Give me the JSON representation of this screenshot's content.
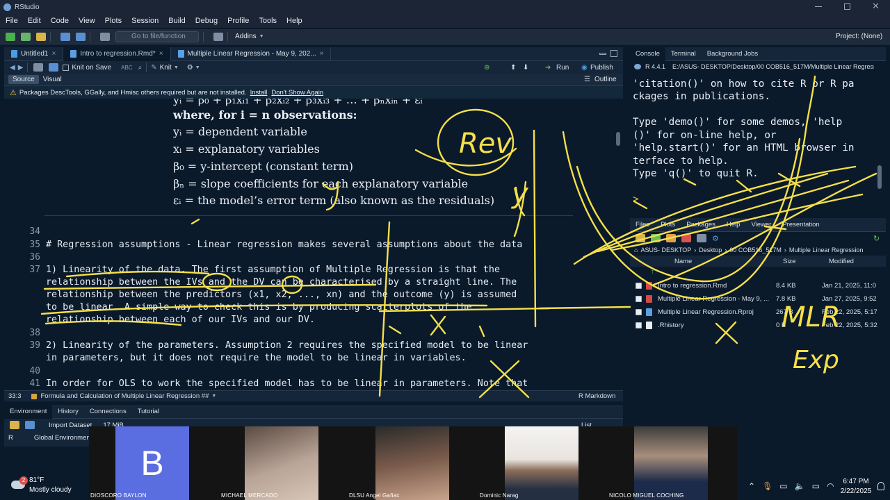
{
  "app": {
    "title": "RStudio"
  },
  "menu": [
    "File",
    "Edit",
    "Code",
    "View",
    "Plots",
    "Session",
    "Build",
    "Debug",
    "Profile",
    "Tools",
    "Help"
  ],
  "toolbar": {
    "goto_file": "Go to file/function",
    "addins": "Addins",
    "project": "Project: (None)"
  },
  "editor": {
    "tabs": [
      {
        "label": "Untitled1",
        "close": "×"
      },
      {
        "label": "Intro to regression.Rmd*",
        "close": "×"
      },
      {
        "label": "Multiple Linear Regression - May 9, 202...",
        "close": "×"
      }
    ],
    "knit_on_save": "Knit on Save",
    "knit": "Knit",
    "run": "Run",
    "publish": "Publish",
    "source": "Source",
    "visual": "Visual",
    "outline": "Outline",
    "warning": {
      "text": "Packages DescTools, GGally, and Hmisc others required but are not installed.",
      "install": "Install",
      "dont_show": "Don't Show Again"
    },
    "math": [
      "yᵢ = β₀ + β₁xᵢ₁ + β₂xᵢ₂ + β₃xᵢ₃ + … + βₙxᵢₙ + εᵢ",
      "where, for i = n observations:",
      "yᵢ = dependent variable",
      "xᵢ = explanatory variables",
      "β₀ = y-intercept (constant term)",
      "βₙ = slope coefficients for each explanatory variable",
      "εᵢ = the model’s error term (also known as the residuals)"
    ],
    "lines": [
      {
        "num": "34",
        "text": ""
      },
      {
        "num": "35",
        "text": "# Regression assumptions - Linear regression makes several assumptions about the data"
      },
      {
        "num": "36",
        "text": ""
      },
      {
        "num": "37",
        "text": "1) Linearity of the data. The first assumption of Multiple Regression is that the"
      },
      {
        "num": "",
        "text": "relationship between the IVs and the DV can be characterised by a straight line. The"
      },
      {
        "num": "",
        "text": "relationship between the predictors (x1, x2, ..., xn) and the outcome (y) is assumed"
      },
      {
        "num": "",
        "text": "to be linear. A simple way to check this is by producing scatterplots of the"
      },
      {
        "num": "",
        "text": "relationship between each of our IVs and our DV."
      },
      {
        "num": "38",
        "text": ""
      },
      {
        "num": "39",
        "text": "2) Linearity of the parameters. Assumption 2 requires the specified model to be linear"
      },
      {
        "num": "",
        "text": "in parameters, but it does not require the model to be linear in variables."
      },
      {
        "num": "40",
        "text": ""
      },
      {
        "num": "41",
        "text": "In order for OLS to work the specified model has to be linear in parameters. Note that"
      }
    ],
    "status": {
      "pos": "33:3",
      "section": "Formula and Calculation of Multiple Linear Regression ##",
      "mode": "R Markdown"
    }
  },
  "env": {
    "tabs": [
      "Environment",
      "History",
      "Connections",
      "Tutorial"
    ],
    "import": "Import Dataset",
    "mem": "17 MiB",
    "lang": "R",
    "scope": "Global Environment",
    "list": "List"
  },
  "console": {
    "tabs": [
      "Console",
      "Terminal",
      "Background Jobs"
    ],
    "version": "R 4.4.1",
    "path": "E:/ASUS- DESKTOP/Desktop/00 COB516_517M/Multiple Linear Regressi",
    "lines": [
      "'citation()' on how to cite R or R pa",
      "ckages in publications.",
      "",
      "Type 'demo()' for some demos, 'help",
      "()' for on-line help, or",
      "'help.start()' for an HTML browser in",
      "terface to help.",
      "Type 'q()' to quit R.",
      "",
      ">"
    ]
  },
  "files": {
    "tabs": [
      "Files",
      "Plots",
      "Packages",
      "Help",
      "Viewer",
      "Presentation"
    ],
    "breadcrumb": [
      "ASUS- DESKTOP",
      "Desktop",
      "00 COB516_517M",
      "Multiple Linear Regression"
    ],
    "headers": [
      "Name",
      "Size",
      "Modified"
    ],
    "rows": [
      {
        "name": "Intro to regression.Rmd",
        "size": "8.4 KB",
        "modified": "Jan 21, 2025, 11:0"
      },
      {
        "name": "Multiple Linear Regression - May 9, ...",
        "size": "7.8 KB",
        "modified": "Jan 27, 2025, 9:52"
      },
      {
        "name": "Multiple Linear Regression.Rproj",
        "size": "267 B",
        "modified": "Feb 22, 2025, 5:17"
      },
      {
        "name": ".Rhistory",
        "size": "0 B",
        "modified": "Feb 22, 2025, 5:32"
      }
    ]
  },
  "participants": [
    {
      "name": "DIOSCORO BAYLON",
      "initial": "B"
    },
    {
      "name": "MICHAEL MERCADO"
    },
    {
      "name": "DLSU Angel Gañac"
    },
    {
      "name": "Dominic Narag"
    },
    {
      "name": "NICOLO MIGUEL COCHING"
    }
  ],
  "taskbar": {
    "temp": "81°F",
    "weather": "Mostly cloudy",
    "badge": "2",
    "time": "6:47 PM",
    "date": "2/22/2025"
  },
  "annotations": {
    "rev": "Rev",
    "y": "y",
    "mlr": "MLR",
    "exp": "Exp"
  },
  "colors": {
    "accent": "#f5e04a",
    "editor_bg": "#0b1a2b",
    "zoom_blue": "#5b6ee1"
  }
}
